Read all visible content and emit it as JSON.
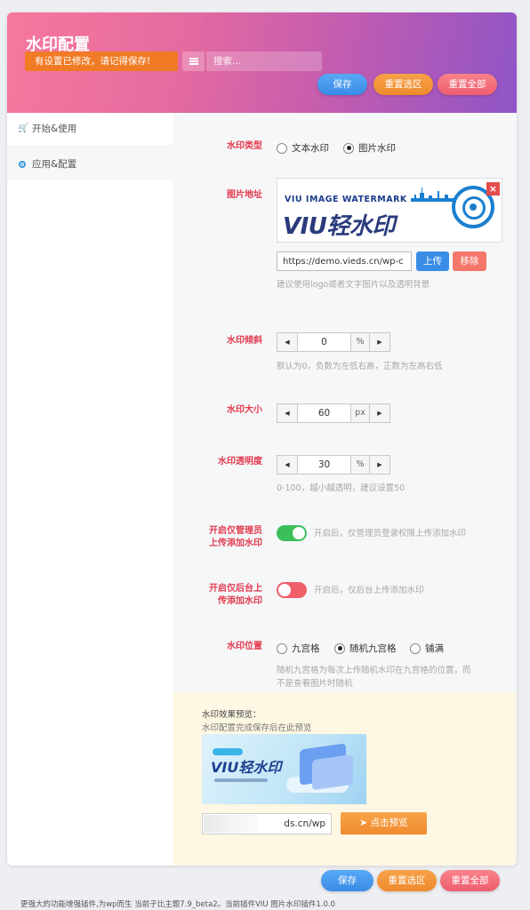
{
  "header": {
    "title": "水印配置",
    "notice": "有设置已修改，请记得保存!",
    "search_placeholder": "搜索..."
  },
  "buttons": {
    "save": "保存",
    "reset_section": "重置选区",
    "reset_all": "重置全部"
  },
  "sidebar": {
    "items": [
      {
        "label": "开始&使用",
        "icon": "cart-icon"
      },
      {
        "label": "应用&配置",
        "icon": "radio-dot-icon"
      }
    ]
  },
  "fields": {
    "type": {
      "label": "水印类型",
      "options": [
        "文本水印",
        "图片水印"
      ],
      "selected": "图片水印"
    },
    "image": {
      "label": "图片地址",
      "logo_top": "VIU IMAGE WATERMARK",
      "logo_main": "VIU轻水印",
      "url": "https://demo.vieds.cn/wp-c",
      "upload": "上传",
      "remove": "移除",
      "hint": "建议使用logo或者文字图片以及透明背景"
    },
    "tilt": {
      "label": "水印倾斜",
      "value": "0",
      "unit": "%",
      "hint": "默认为0，负数为左低右高，正数为左高右低"
    },
    "size": {
      "label": "水印大小",
      "value": "60",
      "unit": "px"
    },
    "opacity": {
      "label": "水印透明度",
      "value": "30",
      "unit": "%",
      "hint": "0-100，越小越透明，建议设置50"
    },
    "admin_only": {
      "label_line1": "开启仅管理员",
      "label_line2": "上传添加水印",
      "enabled": true,
      "hint": "开启后，仅管理员登录权限上传添加水印"
    },
    "backend_only": {
      "label_line1": "开启仅后台上",
      "label_line2": "传添加水印",
      "enabled": false,
      "hint": "开启后，仅后台上传添加水印"
    },
    "position": {
      "label": "水印位置",
      "options": [
        "九宫格",
        "随机九宫格",
        "铺满"
      ],
      "selected": "随机九宫格",
      "hint_line1": "随机九宫格为每次上传随机水印在九宫格的位置，而",
      "hint_line2": "不是查看图片时随机"
    }
  },
  "preview": {
    "title": "水印效果预览：",
    "subtitle": "水印配置完成保存后在此预览",
    "image_text": "VIU轻水印",
    "url": "ds.cn/wp",
    "button": "点击预览"
  },
  "footer": {
    "text": "更强大的功能增强插件,为wp而生 当前子比主题7.9_beta2。当前插件VIU 图片水印插件1.0.0"
  },
  "colors": {
    "accent_label": "#e23a4d",
    "toggle_on": "#3bbf5a",
    "toggle_off": "#f05e6a",
    "notice": "#f07b24"
  }
}
